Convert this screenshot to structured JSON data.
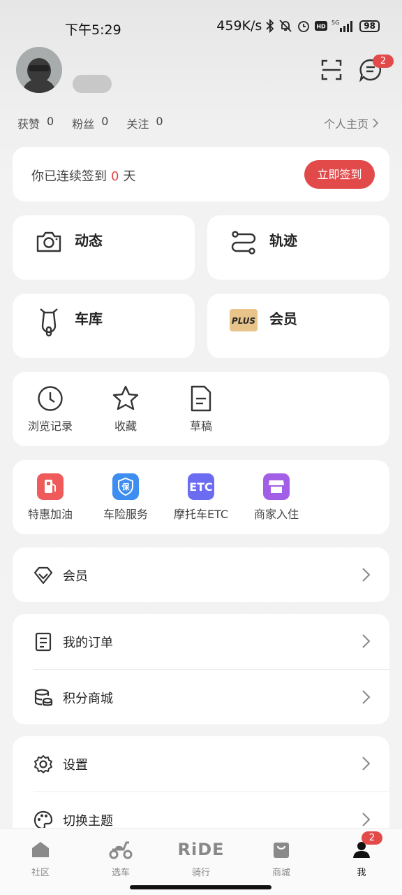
{
  "status_bar": {
    "time": "下午5:29",
    "speed": "459K/s",
    "battery": "98"
  },
  "header": {
    "message_badge": "2"
  },
  "stats": [
    {
      "label": "获赞",
      "value": "0"
    },
    {
      "label": "粉丝",
      "value": "0"
    },
    {
      "label": "关注",
      "value": "0"
    }
  ],
  "homepage_link": "个人主页",
  "checkin": {
    "prefix": "你已连续签到",
    "days": "0",
    "suffix": "天",
    "button": "立即签到"
  },
  "tiles": [
    {
      "label": "动态",
      "icon": "camera-icon"
    },
    {
      "label": "轨迹",
      "icon": "route-icon"
    },
    {
      "label": "车库",
      "icon": "scooter-icon"
    },
    {
      "label": "会员",
      "icon": "plus-badge-icon",
      "icon_text": "PLUS"
    }
  ],
  "shortcuts": [
    {
      "label": "浏览记录",
      "icon": "clock-icon"
    },
    {
      "label": "收藏",
      "icon": "star-icon"
    },
    {
      "label": "草稿",
      "icon": "document-icon"
    }
  ],
  "services": [
    {
      "label": "特惠加油",
      "icon": "fuel-icon",
      "color": "#ef5a5a"
    },
    {
      "label": "车险服务",
      "icon": "insurance-icon",
      "color": "#3d8ef0",
      "icon_text": "保"
    },
    {
      "label": "摩托车ETC",
      "icon": "etc-icon",
      "color": "#6b6cf2",
      "icon_text": "ETC"
    },
    {
      "label": "商家入住",
      "icon": "shop-icon",
      "color": "#a35ee8"
    }
  ],
  "menu": {
    "member": "会员",
    "orders": "我的订单",
    "points_mall": "积分商城",
    "settings": "设置",
    "theme": "切换主题"
  },
  "tabbar": {
    "items": [
      {
        "label": "社区",
        "icon": "home-icon"
      },
      {
        "label": "选车",
        "icon": "scooter-icon"
      },
      {
        "label": "骑行",
        "icon": "ride-logo",
        "logo_text": "RiDE"
      },
      {
        "label": "商城",
        "icon": "bag-icon"
      },
      {
        "label": "我",
        "icon": "profile-icon"
      }
    ],
    "active": "我",
    "profile_badge": "2"
  },
  "colors": {
    "accent": "#e24a4a",
    "background": "#f3f3f3"
  }
}
